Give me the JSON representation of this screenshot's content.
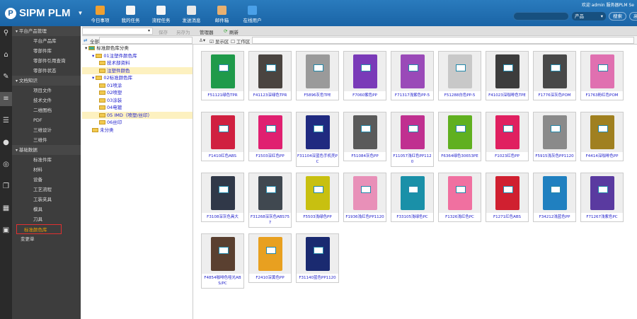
{
  "header": {
    "brand": "SIPM PLM",
    "nav": [
      {
        "label": "今日事项",
        "color": "#f0a030"
      },
      {
        "label": "我的任务",
        "color": "#f5f5f5"
      },
      {
        "label": "流程任务",
        "color": "#f5f5f5"
      },
      {
        "label": "发送消息",
        "color": "#e8e8e8"
      },
      {
        "label": "邮件箱",
        "color": "#e8b070"
      },
      {
        "label": "在线用户",
        "color": "#4aa0e8"
      }
    ],
    "welcome": "欢迎 admin  服务器PLM Se",
    "search_value": "",
    "scope": "产品",
    "search_btn": "搜索",
    "adv_btn": "高"
  },
  "sidebar": {
    "groups": [
      {
        "label": "平台产品管理",
        "items": [
          "平台产品库",
          "零部件库",
          "零部件引用查询",
          "零部件状态"
        ]
      },
      {
        "label": "文档知识",
        "items": [
          "项目文件",
          "技术文件",
          "二维图档",
          "PDF",
          "三维设计",
          "三维件"
        ]
      },
      {
        "label": "基础数据",
        "items": [
          "标准件库",
          "材料",
          "设备",
          "工艺流程",
          "工装夹具",
          "模具",
          "刀具",
          "标准颜色库"
        ]
      }
    ],
    "extra": "变更单",
    "selected": "标准颜色库"
  },
  "toolbar": {
    "save": "保存",
    "save_as": "另存为",
    "manager": "管理器",
    "refresh": "刷新",
    "all": "全部",
    "show_area": "显示区",
    "work_area": "工作区"
  },
  "tree": [
    {
      "label": "标准颜色库分类",
      "level": 0
    },
    {
      "label": "01注塑件颜色库",
      "level": 1
    },
    {
      "label": "技术部资料",
      "level": 2
    },
    {
      "label": "注塑件颜色",
      "level": 2,
      "hl": true
    },
    {
      "label": "02标准颜色库",
      "level": 1
    },
    {
      "label": "01喷涂",
      "level": 2
    },
    {
      "label": "02喷塑",
      "level": 2
    },
    {
      "label": "03涂装",
      "level": 2
    },
    {
      "label": "04电镀",
      "level": 2
    },
    {
      "label": "05 IMD（喷塑/丝印）",
      "level": 2,
      "hl": true
    },
    {
      "label": "06丝印",
      "level": 2
    },
    {
      "label": "未分类",
      "level": 1
    }
  ],
  "items": [
    {
      "name": "F51121绿色TPR",
      "color": "#1f9a4a"
    },
    {
      "name": "F41123深绿色TPR",
      "color": "#4a4440"
    },
    {
      "name": "F5896灰色TPE",
      "color": "#9a9a9a"
    },
    {
      "name": "F7060紫色PP",
      "color": "#7a3ab8"
    },
    {
      "name": "F71317浅紫色PP-5",
      "color": "#9a4ab8"
    },
    {
      "name": "F51288白色PP-5",
      "color": "#c8c8c8"
    },
    {
      "name": "F41023深咖啡色TPE",
      "color": "#3c3c3c"
    },
    {
      "name": "F1776深灰色POM",
      "color": "#484848"
    },
    {
      "name": "F1763粉红色POM",
      "color": "#e070b0"
    },
    {
      "name": "F1410红色ABS",
      "color": "#d02040"
    },
    {
      "name": "F1503深红色PP",
      "color": "#e02070"
    },
    {
      "name": "F31104深蓝色手机壳PC",
      "color": "#202a80"
    },
    {
      "name": "F51084灰色PP",
      "color": "#5a5a5a"
    },
    {
      "name": "F11057浅红色PP1120",
      "color": "#c03090"
    },
    {
      "name": "F6364绿色30653PE",
      "color": "#60b020"
    },
    {
      "name": "F1023红色PP",
      "color": "#e02060"
    },
    {
      "name": "F5915浅灰色PP1120",
      "color": "#8a8a8a"
    },
    {
      "name": "F4414深咖啡色PP",
      "color": "#a08020"
    },
    {
      "name": "F3108深灰色具大",
      "color": "#303848"
    },
    {
      "name": "F31268深灰色ABS757",
      "color": "#404850"
    },
    {
      "name": "F5503浅绿色PP",
      "color": "#c8c010"
    },
    {
      "name": "F1936浅红色PP1120",
      "color": "#e890b8"
    },
    {
      "name": "F33105浅绿色PC",
      "color": "#1a90a8"
    },
    {
      "name": "F1326浅红色PC",
      "color": "#f070a0"
    },
    {
      "name": "F1271红色ABS",
      "color": "#d02030"
    },
    {
      "name": "F34212浅蓝色PP",
      "color": "#2080c0"
    },
    {
      "name": "F71267浅紫色PC",
      "color": "#5a3aa0"
    },
    {
      "name": "F4854咖啡色哑光ABS/PC",
      "color": "#5a4030"
    },
    {
      "name": "F2410深黄色PP",
      "color": "#e8a020"
    },
    {
      "name": "F31140蓝色PP1120",
      "color": "#1a2a70"
    }
  ]
}
